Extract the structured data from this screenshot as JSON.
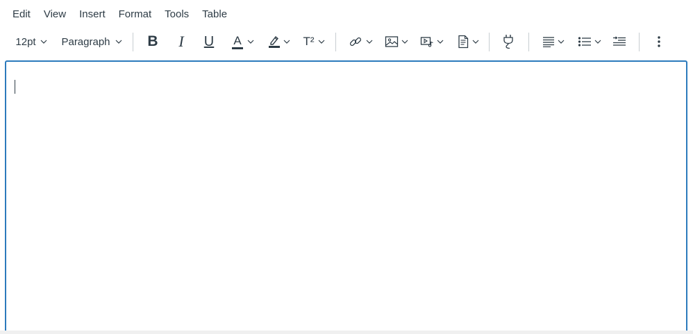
{
  "menubar": {
    "items": [
      "Edit",
      "View",
      "Insert",
      "Format",
      "Tools",
      "Table"
    ]
  },
  "toolbar": {
    "font_size": "12pt",
    "block_format": "Paragraph",
    "bold_label": "B",
    "italic_label": "I",
    "underline_label": "U",
    "text_color_label": "A",
    "superscript_label": "T²",
    "icons": {
      "font_size_dropdown": "chevron-down-icon",
      "block_dropdown": "chevron-down-icon",
      "link": "link-icon",
      "image": "image-icon",
      "media": "media-icon",
      "document": "document-icon",
      "apps": "plug-icon",
      "align": "align-left-icon",
      "list": "bullet-list-icon",
      "indent": "indent-icon",
      "more": "more-vertical-icon"
    }
  },
  "colors": {
    "accent_border": "#2b7abc",
    "text": "#2d3b45",
    "separator": "#c7cdd1"
  },
  "editor": {
    "content": ""
  }
}
